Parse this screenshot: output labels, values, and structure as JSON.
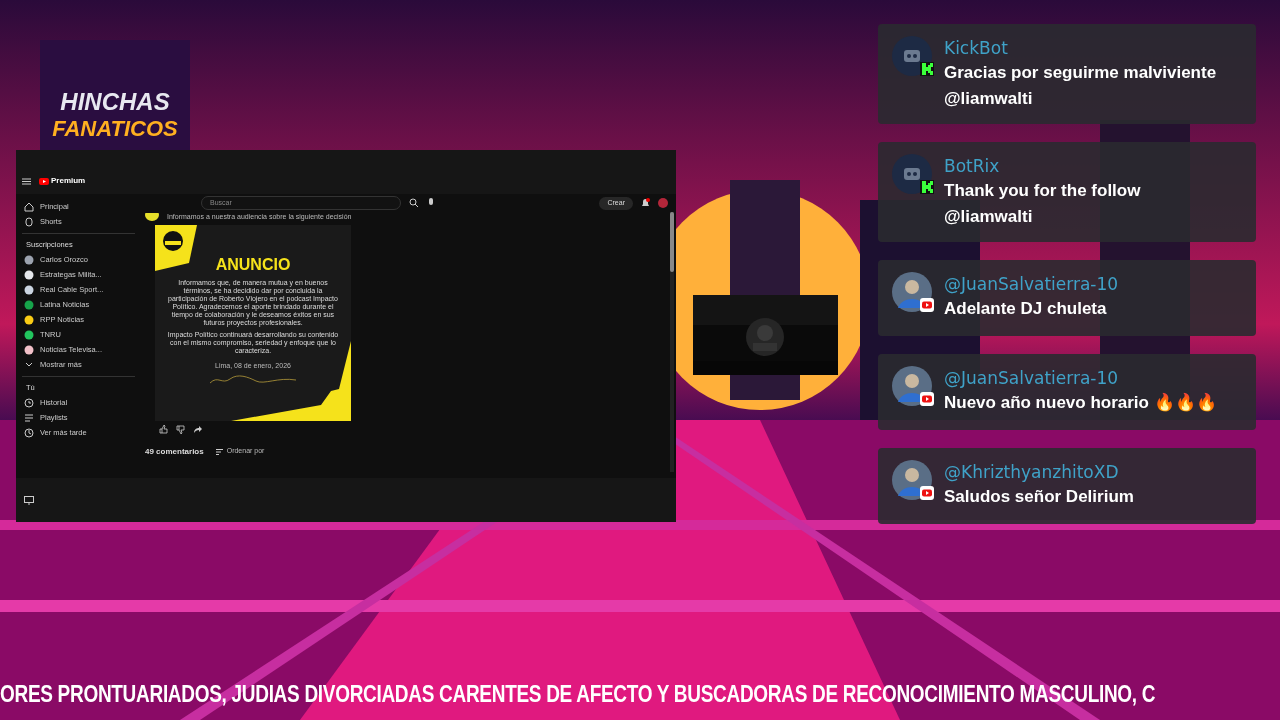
{
  "logo": {
    "line_1": "HINCHAS",
    "line_2": "FANATICOS"
  },
  "captured_window": {
    "brand": "Premium",
    "search": {
      "placeholder": "Buscar"
    },
    "create_button": "Crear",
    "nav": [
      {
        "label": "Principal"
      },
      {
        "label": "Shorts"
      }
    ],
    "subscriptions_heading": "Suscripciones",
    "subscriptions": [
      {
        "label": "Carlos Orozco",
        "color": "#9ca3af"
      },
      {
        "label": "Estrategas Milita...",
        "color": "#e5e7eb"
      },
      {
        "label": "Real Cable Sport...",
        "color": "#cbd5e1"
      },
      {
        "label": "Latina Noticias",
        "color": "#16a34a"
      },
      {
        "label": "RPP Noticias",
        "color": "#facc15"
      },
      {
        "label": "TNRU",
        "color": "#22c55e"
      },
      {
        "label": "Noticias Televisa...",
        "color": "#f1c0c8"
      }
    ],
    "show_more": "Mostrar más",
    "you_heading": "Tú",
    "you_items": [
      {
        "label": "Historial"
      },
      {
        "label": "Playlists"
      },
      {
        "label": "Ver más tarde"
      }
    ],
    "post": {
      "caption": "Informamos a nuestra audiencia sobre la siguiente decisión",
      "title": "ANUNCIO",
      "paragraphs": [
        "Informamos que, de manera mutua y en buenos términos, se ha decidido dar por concluida la participación de Roberto Viojero en el podcast Impacto Político. Agradecemos el aporte brindado durante el tiempo de colaboración y le deseamos éxitos en sus futuros proyectos profesionales.",
        "Impacto Político continuará desarrollando su contenido con el mismo compromiso, seriedad y enfoque que lo caracteriza."
      ],
      "date": "Lima, 08 de enero, 2026"
    },
    "comments_count": "49 comentarios",
    "sort_label": "Ordenar por"
  },
  "chat": [
    {
      "user": "KickBot",
      "kind": "kick",
      "message": "Gracias por seguirme malviviente @liamwalti"
    },
    {
      "user": "BotRix",
      "kind": "kick",
      "message": "Thank you for the follow @liamwalti"
    },
    {
      "user": "@JuanSalvatierra-10",
      "kind": "youtube",
      "message": "Adelante DJ chuleta"
    },
    {
      "user": "@JuanSalvatierra-10",
      "kind": "youtube",
      "message": "Nuevo año nuevo horario 🔥🔥🔥"
    },
    {
      "user": "@KhrizthyanzhitoXD",
      "kind": "youtube",
      "message": "Saludos señor Delirium"
    }
  ],
  "ticker": "ORES PRONTUARIADOS, JUDIAS DIVORCIADAS CARENTES DE AFECTO Y BUSCADORAS DE RECONOCIMIENTO MASCULINO, C"
}
